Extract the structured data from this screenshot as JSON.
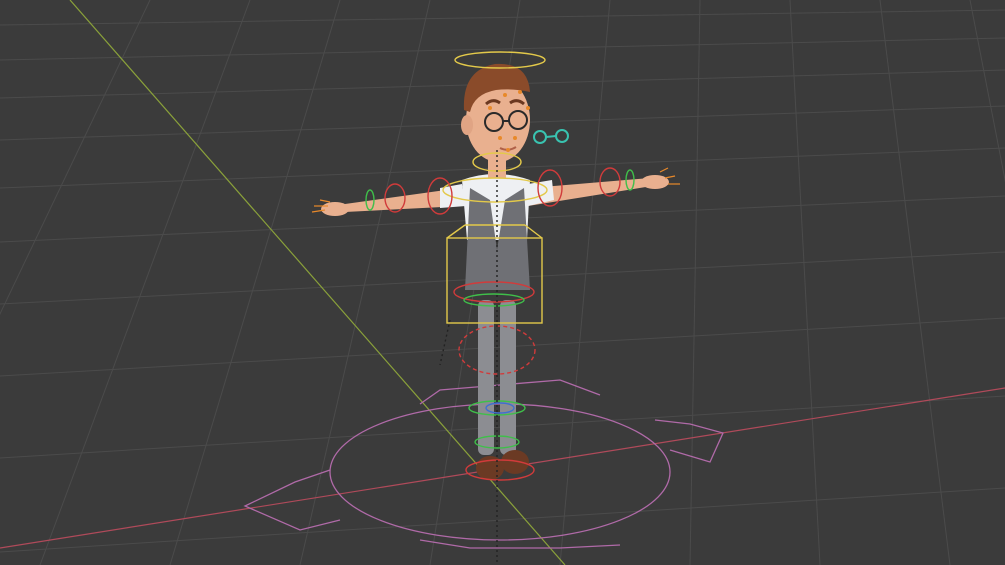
{
  "viewport": {
    "background": "#3b3b3b",
    "grid_color": "#4a4a4a",
    "x_axis_color": "#b04a5a",
    "y_axis_color": "#8aa13a"
  },
  "character": {
    "skin": "#e9b08f",
    "hair": "#8a4b2a",
    "shirt": "#eef0f3",
    "vest": "#6f7075",
    "pants": "#8c8d92",
    "shoes": "#6b3a24",
    "glasses": "#2a2a2a"
  },
  "rig": {
    "control_yellow": "#e3c94a",
    "control_red": "#d13b3b",
    "control_green": "#3fbf4a",
    "control_blue": "#3f6fd1",
    "control_cyan": "#39c3b0",
    "root_control": "#b06aa8"
  }
}
